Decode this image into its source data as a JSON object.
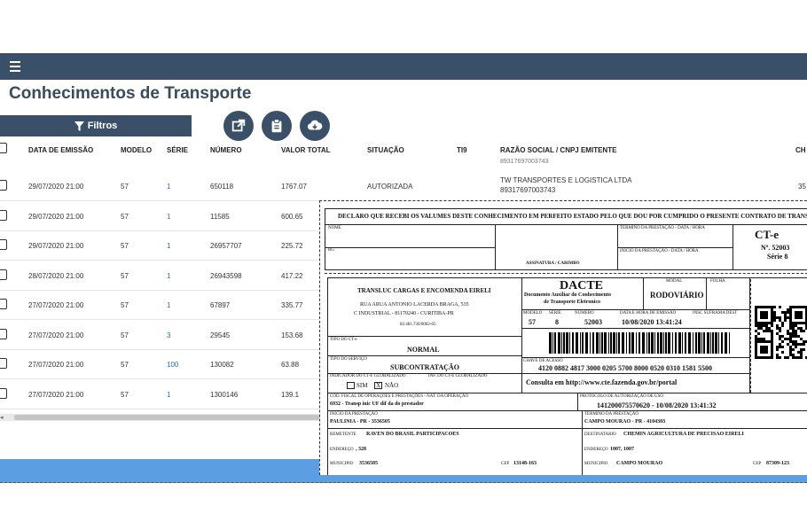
{
  "page": {
    "title": "Conhecimentos de Transporte"
  },
  "toolbar": {
    "filter_label": "Filtros"
  },
  "table": {
    "headers": [
      "DATA DE EMISSÃO",
      "MODELO",
      "SÉRIE",
      "NÚMERO",
      "VALOR TOTAL",
      "SITUAÇÃO",
      "TI9",
      "RAZÃO SOCIAL / CNPJ EMITENTE",
      "CH"
    ],
    "header_fragment": "89317697003743",
    "rows": [
      {
        "data": "29/07/2020 21:00",
        "modelo": "57",
        "serie": "1",
        "numero": "650118",
        "valor": "1767.07",
        "situacao": "AUTORIZADA",
        "razao": "TW TRANSPORTES E LOGISTICA LTDA",
        "cnpj": "89317697003743",
        "ch": "35"
      },
      {
        "data": "29/07/2020 21:00",
        "modelo": "57",
        "serie": "1",
        "numero": "11585",
        "valor": "600.65"
      },
      {
        "data": "29/07/2020 21:00",
        "modelo": "57",
        "serie": "1",
        "numero": "26957707",
        "valor": "225.72"
      },
      {
        "data": "28/07/2020 21:00",
        "modelo": "57",
        "serie": "1",
        "numero": "26943598",
        "valor": "417.22"
      },
      {
        "data": "27/07/2020 21:00",
        "modelo": "57",
        "serie": "1",
        "numero": "67897",
        "valor": "335.77"
      },
      {
        "data": "27/07/2020 21:00",
        "modelo": "57",
        "serie": "3",
        "numero": "29545",
        "valor": "153.68"
      },
      {
        "data": "27/07/2020 21:00",
        "modelo": "57",
        "serie": "100",
        "numero": "130082",
        "valor": "63.88"
      },
      {
        "data": "27/07/2020 21:00",
        "modelo": "57",
        "serie": "1",
        "numero": "1300146",
        "valor": "139.1"
      }
    ]
  },
  "dacte": {
    "declaro": "DECLARO QUE RECEBI OS VALUMES DESTE CONHECIMENTO EM PERFEITO ESTADO PELO QUE DOU POR CUMPRIDO O PRESENTE CONTRATO DE TRANSPO",
    "nome": "NOME",
    "rg": "RG",
    "assinatura": "ASSINATURA / CARIMBO",
    "termino": "TÉRMINO DA PRESTAÇÃO - DATA / HORA",
    "inicio": "INÍCIO DA PRESTAÇÃO - DATA / HORA",
    "cte": "CT-e",
    "numero_label": "Nº. 52003",
    "serie_label": "Série 8",
    "emitente": "TRANSLUC CARGAS E ENCOMENDA EIRELI",
    "endereco": "RUA ARUA ANTONIO LACERDA BRAGA, 535",
    "cidade": "C INDUSTRIAL - 81170240 - CURITIBA-PR",
    "cnpj": "82.481.730/0002-05",
    "dacte_title": "DACTE",
    "dacte_sub1": "Documento Auxiliar do Conhecimento",
    "dacte_sub2": "de Transporte Eletronico",
    "modal_label": "MODAL",
    "modal": "RODOVIÁRIO",
    "folha_label": "FOLHA",
    "modelo_label": "MODELO",
    "serie_lbl": "SÉRIE",
    "numero_lbl": "NÚMERO",
    "data_lbl": "DATA E HORA DE EMISSÃO",
    "insc_lbl": "INSC SUFRAMA DEST",
    "modelo": "57",
    "serie": "8",
    "numero": "52003",
    "data": "10/08/2020 13:41:24",
    "tipo_cte_label": "TIPO DO CT-e",
    "tipo_cte": "NORMAL",
    "tipo_servico_label": "TIPO DO SERVIÇO",
    "tipo_servico": "SUBCONTRATAÇÃO",
    "chave_label": "CHAVE DE ACESSO",
    "chave": "4120 0882 4817 3000 0205 5700 8000 0520 0310 1581 5500",
    "indicador_label": "INDICADOR DO CT-E GLOBALIZADO",
    "inf_label": "INF. DO CT-E GLOBALIZADO",
    "sim": "SIM",
    "nao": "NÃO",
    "check_x": "X",
    "consulta": "Consulta em http://www.cte.fazenda.gov.br/portal",
    "cfop_label": "COD. FISCAL DE OPERAÇÕES E PRESTAÇÕES - NAT. DA OPERAÇÃO",
    "cfop": "6932 - Transp inic UF dif da do prestador",
    "protocolo_label": "PROTOCOLO DE AUTORIZAÇÃO DE USO",
    "protocolo": "141200075570620 - 10/08/2020 13:41:32",
    "inicio_prest_label": "INÍCIO DA PRESTAÇÃO",
    "inicio_prest": "PAULINIA - PR - 3536505",
    "termino_prest_label": "TÉRMINO DA PRESTAÇÃO",
    "termino_prest": "CAMPO MOURAO - PR - 4104303",
    "remetente_label": "REMETENTE",
    "remetente": "RAVEN DO BRASIL PARTICIPACOES",
    "destinatario_label": "DESTINATARIO",
    "destinatario": "CHEMIN AGRICULTURA DE PRECISAO EIRELI",
    "endereco_label": "ENDEREÇO",
    "rem_end": ", 328",
    "dest_end": "1007, 1007",
    "municipio_label": "MUNICIPIO",
    "rem_mun": "3536505",
    "dest_mun": "CAMPO MOURAO",
    "cep_label": "CEP",
    "rem_cep": "13148-163",
    "dest_cep": "87309-123"
  }
}
